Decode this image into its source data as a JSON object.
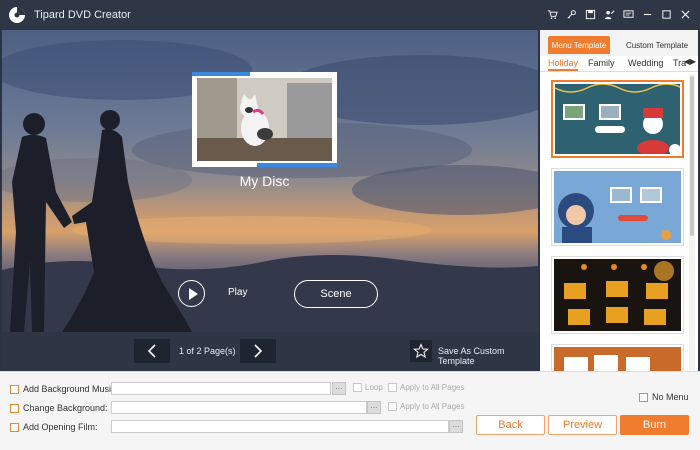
{
  "app": {
    "title": "Tipard DVD Creator",
    "accent_color": "#f07c2d",
    "toolbar_icons": [
      "cart-icon",
      "key-icon",
      "save-icon",
      "register-icon",
      "feedback-icon",
      "minimize-icon",
      "maximize-icon",
      "close-icon"
    ]
  },
  "preview": {
    "disc_title": "My Disc",
    "play_label": "Play",
    "scene_label": "Scene"
  },
  "navigation": {
    "page_info": "1 of 2 Page(s)",
    "save_template_label": "Save As Custom Template"
  },
  "templates": {
    "tabs": [
      {
        "label": "Menu Template",
        "active": true
      },
      {
        "label": "Custom Template",
        "active": false
      }
    ],
    "categories": [
      {
        "label": "Holiday",
        "active": true
      },
      {
        "label": "Family",
        "active": false
      },
      {
        "label": "Wedding",
        "active": false
      },
      {
        "label": "Tra",
        "active": false
      }
    ],
    "category_arrows": "◀▶",
    "items": [
      {
        "theme": "christmas",
        "selected": true
      },
      {
        "theme": "winter-child",
        "selected": false
      },
      {
        "theme": "halloween",
        "selected": false
      },
      {
        "theme": "autumn",
        "selected": false
      }
    ]
  },
  "bottom": {
    "background_music_label": "Add Background Music:",
    "change_background_label": "Change Background:",
    "opening_film_label": "Add Opening Film:",
    "browse_label": "···",
    "loop_label": "Loop",
    "apply_all_music_label": "Apply to All Pages",
    "apply_all_bg_label": "Apply to All Pages",
    "no_menu_label": "No Menu",
    "back_label": "Back",
    "preview_label": "Preview",
    "burn_label": "Burn"
  }
}
